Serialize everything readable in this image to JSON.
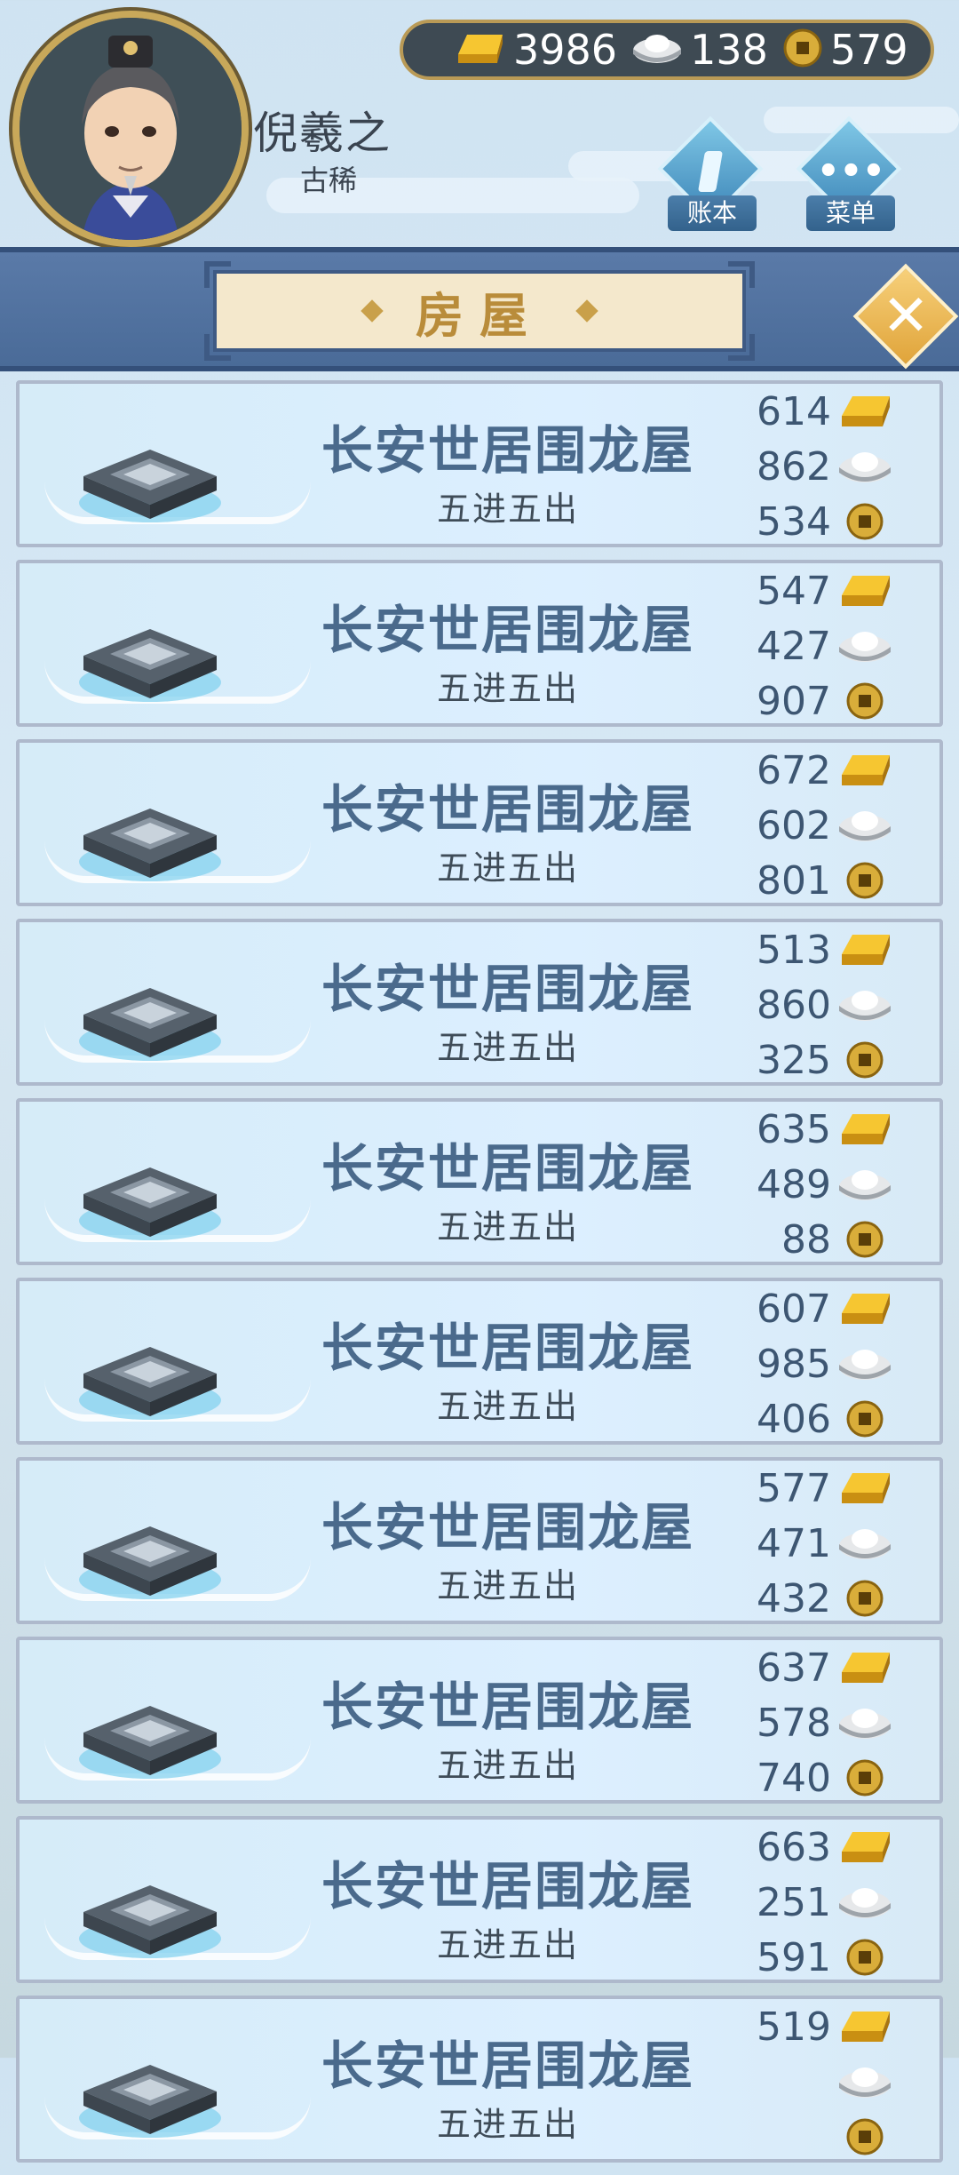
{
  "player": {
    "name": "倪羲之",
    "rank": "古稀"
  },
  "resources": {
    "gold": "3986",
    "silver": "138",
    "coin": "579"
  },
  "hud": {
    "ledger_label": "账本",
    "menu_label": "菜单"
  },
  "panel": {
    "title": "房屋"
  },
  "houses": [
    {
      "name": "长安世居围龙屋",
      "desc": "五进五出",
      "gold": "614",
      "silver": "862",
      "coin": "534"
    },
    {
      "name": "长安世居围龙屋",
      "desc": "五进五出",
      "gold": "547",
      "silver": "427",
      "coin": "907"
    },
    {
      "name": "长安世居围龙屋",
      "desc": "五进五出",
      "gold": "672",
      "silver": "602",
      "coin": "801"
    },
    {
      "name": "长安世居围龙屋",
      "desc": "五进五出",
      "gold": "513",
      "silver": "860",
      "coin": "325"
    },
    {
      "name": "长安世居围龙屋",
      "desc": "五进五出",
      "gold": "635",
      "silver": "489",
      "coin": "88"
    },
    {
      "name": "长安世居围龙屋",
      "desc": "五进五出",
      "gold": "607",
      "silver": "985",
      "coin": "406"
    },
    {
      "name": "长安世居围龙屋",
      "desc": "五进五出",
      "gold": "577",
      "silver": "471",
      "coin": "432"
    },
    {
      "name": "长安世居围龙屋",
      "desc": "五进五出",
      "gold": "637",
      "silver": "578",
      "coin": "740"
    },
    {
      "name": "长安世居围龙屋",
      "desc": "五进五出",
      "gold": "663",
      "silver": "251",
      "coin": "591"
    },
    {
      "name": "长安世居围龙屋",
      "desc": "五进五出",
      "gold": "519",
      "silver": "",
      "coin": ""
    }
  ],
  "icons": {
    "gold": "gold-ingot-icon",
    "silver": "silver-ingot-icon",
    "coin": "copper-coin-icon",
    "ledger": "ledger-icon",
    "menu": "menu-dots-icon",
    "close": "close-icon",
    "house": "house-icon"
  }
}
